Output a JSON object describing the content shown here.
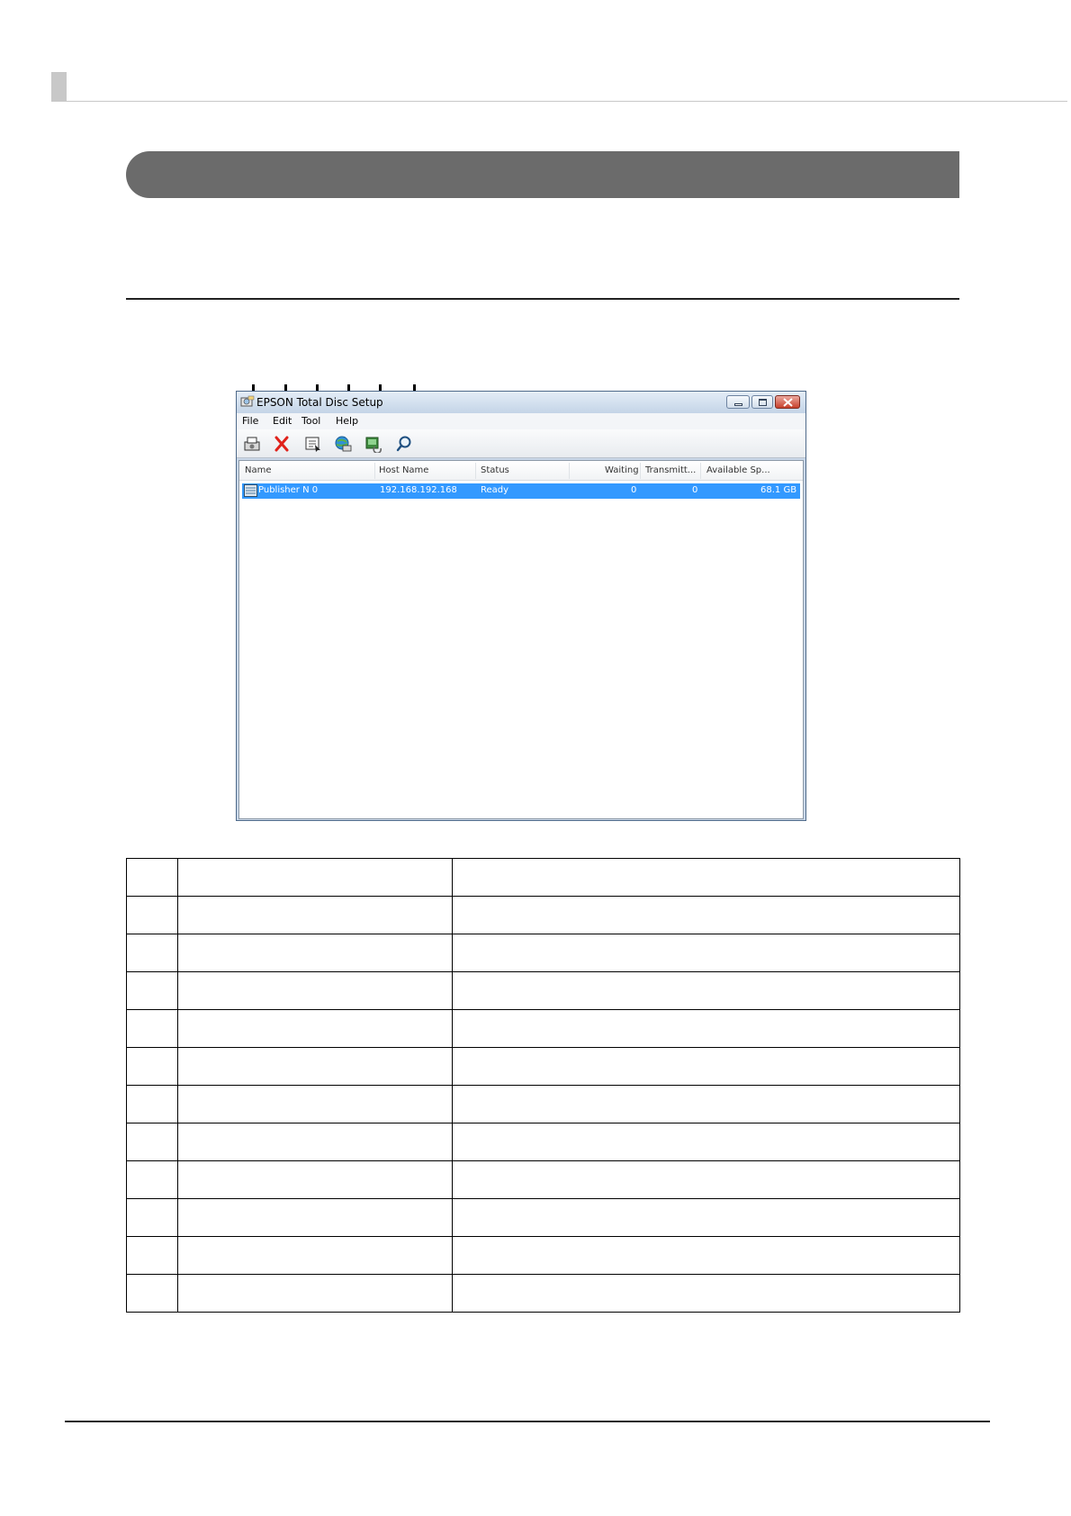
{
  "window": {
    "title": "EPSON Total Disc Setup",
    "menus": [
      "File",
      "Edit",
      "Tool",
      "Help"
    ]
  },
  "toolbar": {
    "icons": [
      "printer-add-icon",
      "delete-icon",
      "properties-icon",
      "network-printer-icon",
      "update-icon",
      "search-icon"
    ]
  },
  "list": {
    "columns": [
      "Name",
      "Host Name",
      "Status",
      "Waiting",
      "Transmitt...",
      "Available Sp..."
    ],
    "rows": [
      {
        "name": "Publisher N 0",
        "host": "192.168.192.168",
        "status": "Ready",
        "waiting": "0",
        "transmitting": "0",
        "available": "68.1 GB"
      }
    ]
  },
  "table": {
    "rows": 12
  },
  "colors": {
    "section_bar": "#6b6b6b",
    "selection": "#3399ff",
    "header_marker": "#c8c8c8"
  }
}
